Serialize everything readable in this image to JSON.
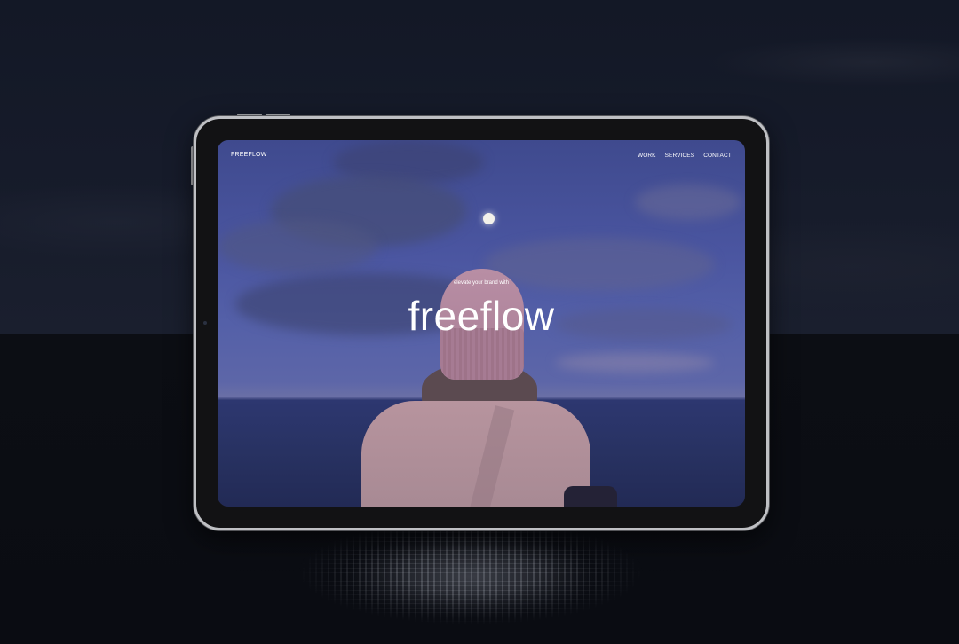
{
  "site": {
    "logo": "FREEFLOW",
    "nav": [
      "WORK",
      "SERVICES",
      "CONTACT"
    ]
  },
  "hero": {
    "tagline": "elevate your brand with",
    "title": "freeflow"
  },
  "colors": {
    "sky": "#4a55a0",
    "sea": "#283262",
    "beanie": "#b88ea4",
    "device_frame": "#bfc0c4",
    "text": "#ffffff"
  }
}
